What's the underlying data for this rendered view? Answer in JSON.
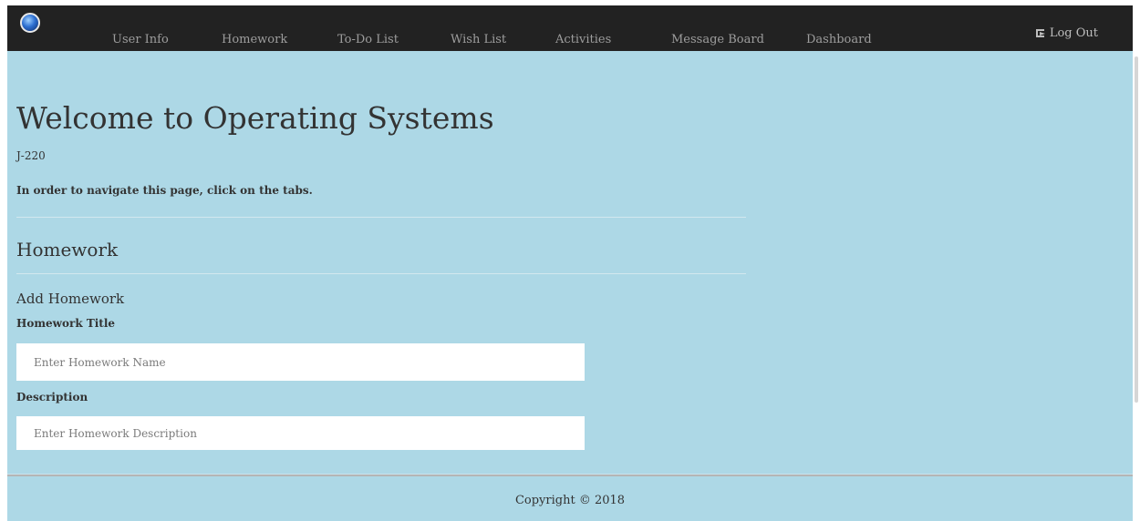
{
  "navbar": {
    "items": [
      {
        "label": "User Info"
      },
      {
        "label": "Homework"
      },
      {
        "label": "To-Do List"
      },
      {
        "label": "Wish List"
      },
      {
        "label": "Activities"
      },
      {
        "label": "Message Board"
      },
      {
        "label": "Dashboard"
      }
    ],
    "logout_label": "Log Out",
    "background": "#222222"
  },
  "main": {
    "title": "Welcome to Operating Systems",
    "course_code": "J-220",
    "instructions": "In order to navigate this page, click on the tabs.",
    "section_title": "Homework",
    "form": {
      "heading": "Add Homework",
      "title_label": "Homework Title",
      "title_placeholder": "Enter Homework Name",
      "description_label": "Description",
      "description_placeholder": "Enter Homework Description"
    },
    "background": "#ADD8E6"
  },
  "footer": {
    "copyright": "Copyright © 2018"
  }
}
